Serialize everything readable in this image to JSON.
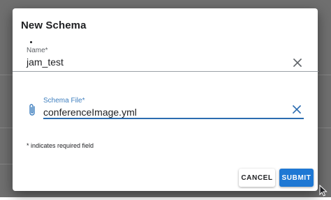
{
  "dialog": {
    "title": "New Schema"
  },
  "name_field": {
    "label": "Name*",
    "value": "jam_test",
    "clear_icon": "close-icon"
  },
  "schema_file_field": {
    "label": "Schema File*",
    "value": "conferenceImage.yml",
    "prefix_icon": "paperclip-icon",
    "clear_icon": "close-icon"
  },
  "required_note": "* indicates required field",
  "actions": {
    "cancel_label": "CANCEL",
    "submit_label": "SUBMIT"
  },
  "colors": {
    "accent": "#1e78d4",
    "focused_underline": "#2b6cb0",
    "backdrop": "#6f6f6f"
  }
}
